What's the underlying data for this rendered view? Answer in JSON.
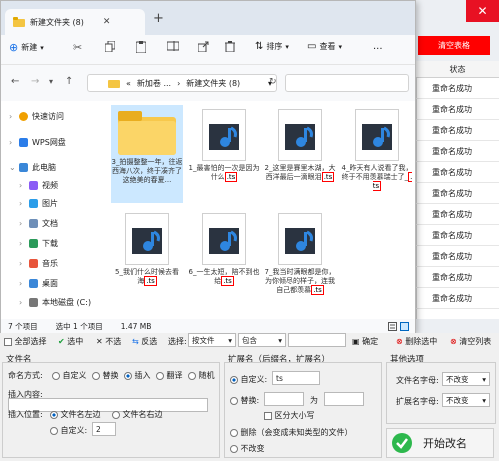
{
  "explorer": {
    "tab_title": "新建文件夹 (8)",
    "toolbar": {
      "new_label": "新建",
      "sort_label": "排序",
      "view_label": "查看",
      "more_label": "..."
    },
    "address": {
      "prefix": "«",
      "part1": "新加卷 ...",
      "part2": "新建文件夹 (8)"
    },
    "nav": [
      {
        "label": "快速访问",
        "icon": "star-icon"
      },
      {
        "label": "WPS网盘",
        "icon": "cloud-icon"
      },
      {
        "label": "此电脑",
        "icon": "pc-icon"
      },
      {
        "label": "视频",
        "icon": "video-folder-icon"
      },
      {
        "label": "图片",
        "icon": "picture-folder-icon"
      },
      {
        "label": "文档",
        "icon": "document-folder-icon"
      },
      {
        "label": "下载",
        "icon": "download-folder-icon"
      },
      {
        "label": "音乐",
        "icon": "music-folder-icon"
      },
      {
        "label": "桌面",
        "icon": "desktop-folder-icon"
      },
      {
        "label": "本地磁盘 (C:)",
        "icon": "drive-icon"
      }
    ],
    "files": [
      {
        "name": "3_拍摄整整一年，往返西海八次，终于凑齐了这绝美的春夏...",
        "ext": "",
        "type": "folder"
      },
      {
        "name": "1_最害怕的一次是因为什么",
        "ext": ".ts",
        "type": "video"
      },
      {
        "name": "2_这里是賽里木湖，大西洋最后一滴眼泪",
        "ext": ".ts",
        "type": "video"
      },
      {
        "name": "4_昨天有人说看了我，终于不用羡慕瑞士了_",
        "ext": ".ts",
        "type": "video"
      },
      {
        "name": "5_我们什么时候去看海",
        "ext": ".ts",
        "type": "video"
      },
      {
        "name": "6_一生太短，陪不到也给",
        "ext": ".ts",
        "type": "video"
      },
      {
        "name": "7_我当时满眼都是你，为你倾尽的样子，连我自己都羡慕",
        "ext": ".ts",
        "type": "video"
      }
    ],
    "status": {
      "count": "7 个项目",
      "selected": "选中 1 个项目",
      "size": "1.47 MB"
    }
  },
  "app": {
    "clear_table": "清空表格",
    "status_header": "状态",
    "status_values": [
      "重命名成功",
      "重命名成功",
      "重命名成功",
      "重命名成功",
      "重命名成功",
      "重命名成功",
      "重命名成功",
      "重命名成功",
      "重命名成功",
      "重命名成功",
      "重命名成功"
    ],
    "filter_row": {
      "select_all": "全部选择",
      "select": "选中",
      "deselect": "不选",
      "invert": "反选",
      "choose": "选择:",
      "type_label": "按文件",
      "contains": "包含",
      "confirm": "确定",
      "delete": "删除选中",
      "clear": "清空列表"
    },
    "filename": {
      "section": "文件名",
      "mode_label": "命名方式:",
      "modes": [
        "自定义",
        "替换",
        "插入",
        "翻译",
        "随机"
      ],
      "insert_content_label": "插入内容:",
      "insert_pos_label": "插入位置:",
      "pos_left": "文件名左边",
      "pos_right": "文件名右边",
      "pos_custom": "自定义:",
      "pos_custom_value": "2"
    },
    "extension": {
      "section": "扩展名（后缀名，扩展名）",
      "custom_label": "自定义:",
      "custom_value": "ts",
      "replace_label": "替换:",
      "replace_as": "为",
      "case_label": "区分大小写",
      "delete_label": "删除（会变成未知类型的文件）",
      "keep_label": "不改变"
    },
    "others": {
      "section": "其他选项",
      "filename_case_label": "文件名字母:",
      "filename_case_value": "不改变",
      "ext_case_label": "扩展名字母:",
      "ext_case_value": "不改变"
    },
    "start_label": "开始改名"
  }
}
